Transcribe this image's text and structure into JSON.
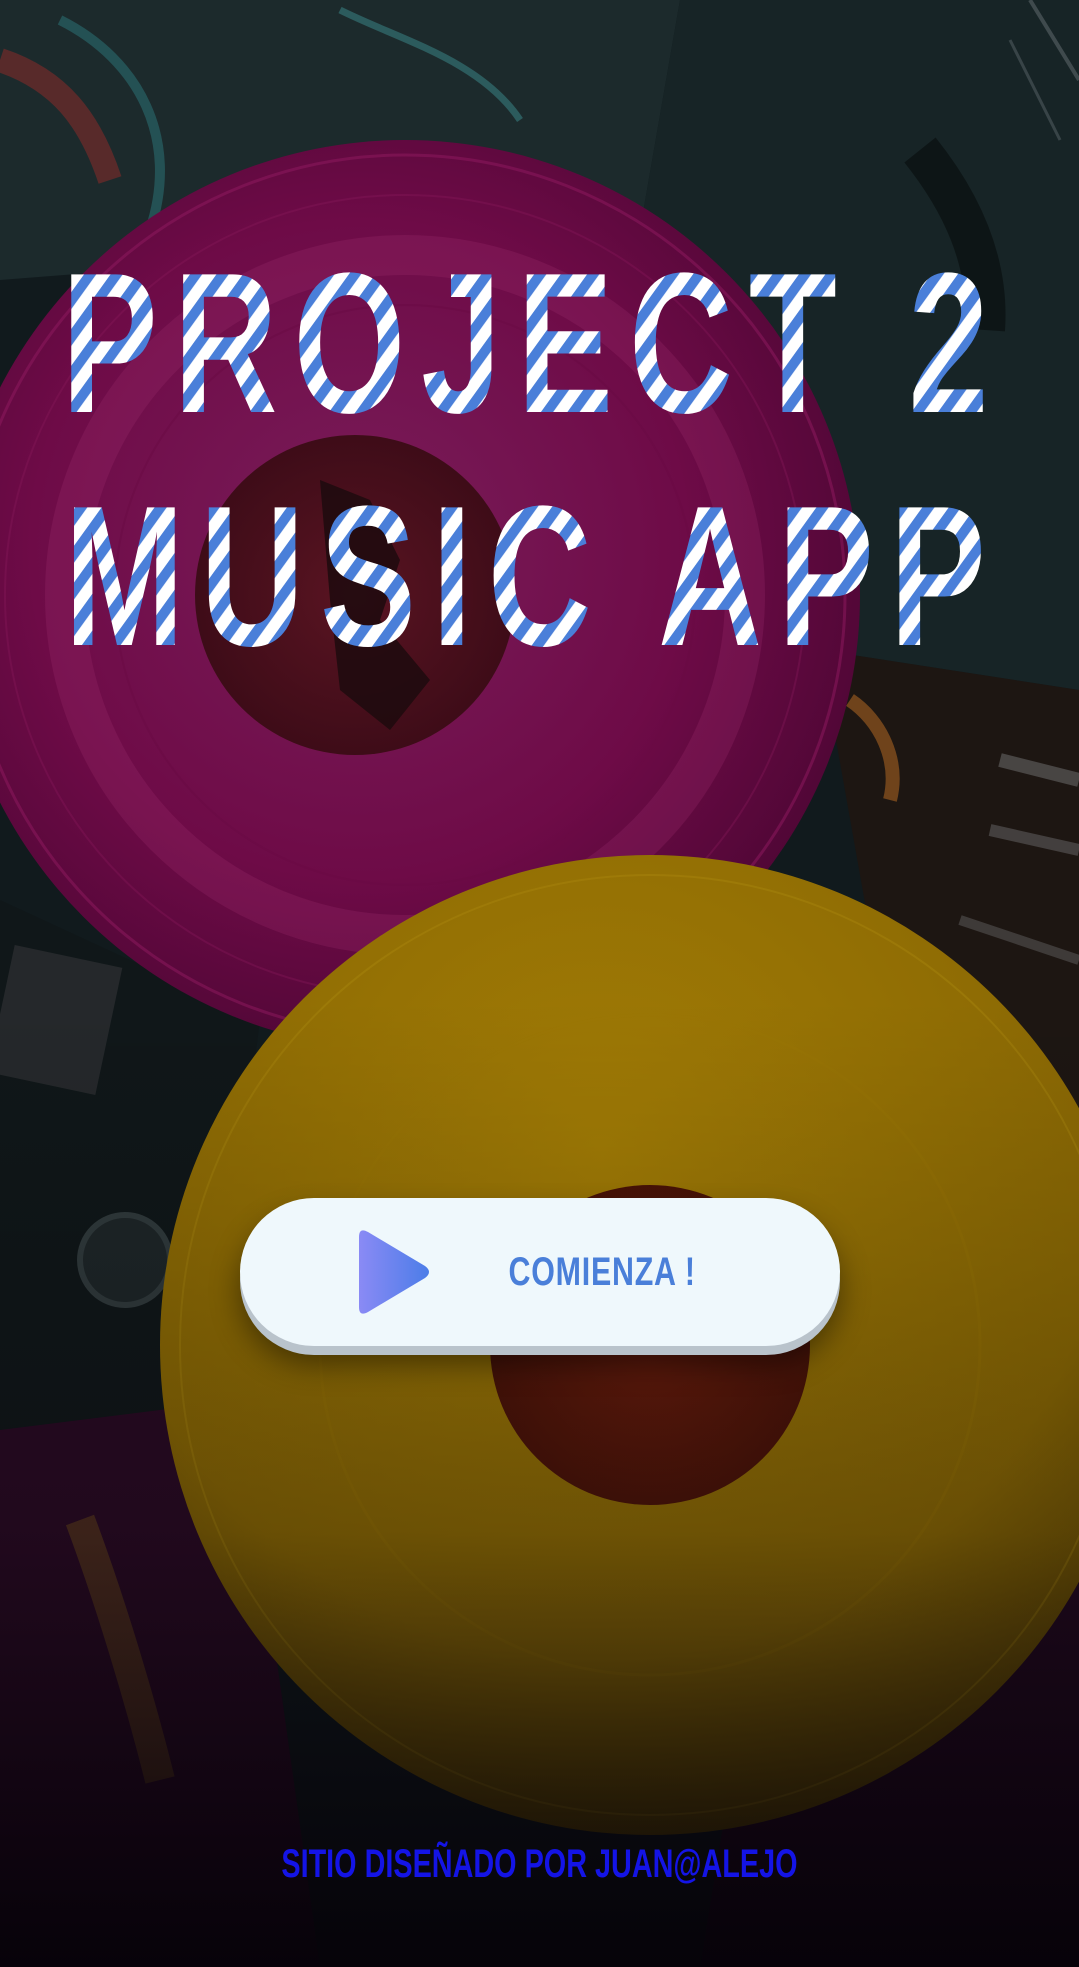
{
  "hero": {
    "title_line1": "PROJECT 2",
    "title_line2": "MUSIC APP"
  },
  "start_button": {
    "label": "COMIENZA !",
    "icon": "play-icon"
  },
  "footer": {
    "credit": "SITIO DISEÑADO POR JUAN@ALEJO"
  },
  "colors": {
    "title_stripe": "#4a7fd9",
    "button_bg": "#eff8fc",
    "button_text": "#4a7fd9",
    "link": "#1414e6",
    "pink_vinyl": "#8a0a52",
    "yellow_vinyl": "#a88200"
  }
}
